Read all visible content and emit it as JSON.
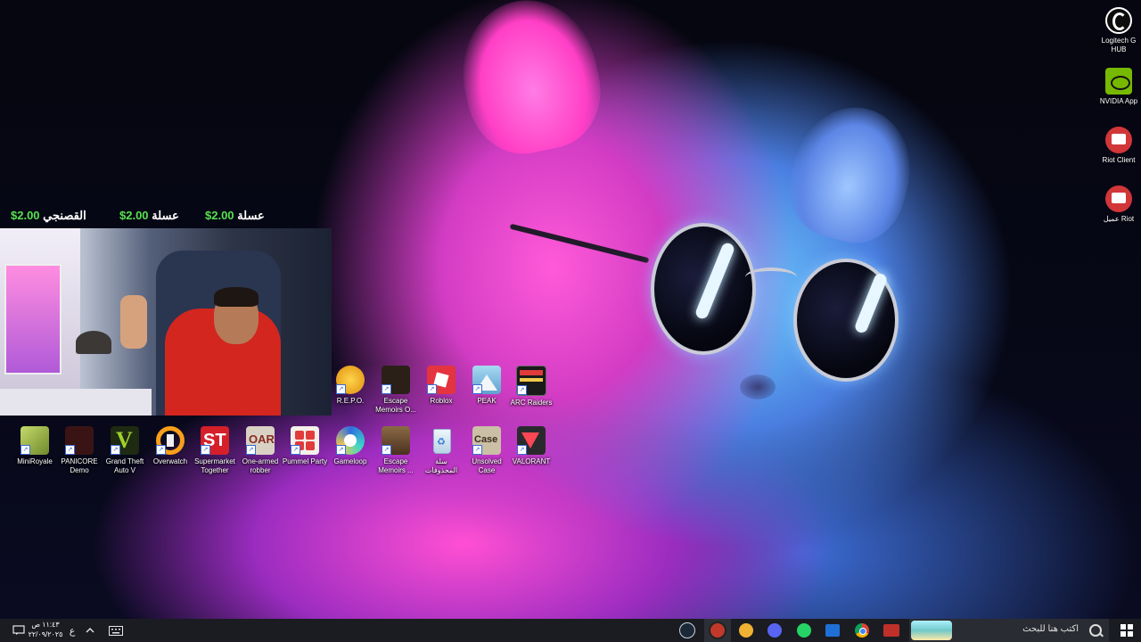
{
  "donations": [
    {
      "name": "القصنجي",
      "amount": "2.00$"
    },
    {
      "name": "عسلة",
      "amount": "2.00$"
    },
    {
      "name": "عسلة",
      "amount": "2.00$"
    }
  ],
  "right_icons": [
    {
      "label": "Logitech G HUB",
      "icon": "logitech-ghub-icon",
      "color": "#ffffff"
    },
    {
      "label": "NVIDIA App",
      "icon": "nvidia-icon",
      "color": "#76b900"
    },
    {
      "label": "Riot Client",
      "icon": "riot-client-icon",
      "color": "#d13639"
    },
    {
      "label": "عميل Riot",
      "icon": "riot-client-icon",
      "color": "#d13639"
    }
  ],
  "top_row_icons": [
    {
      "label": "R.E.P.O.",
      "icon": "repo-icon",
      "color": "#e8a322"
    },
    {
      "label": "Escape Memoirs O...",
      "icon": "escape-memoirs-icon",
      "color": "#2a2018"
    },
    {
      "label": "Roblox",
      "icon": "roblox-icon",
      "color": "#e3343f"
    },
    {
      "label": "PEAK",
      "icon": "peak-icon",
      "color": "#7ec2e6"
    },
    {
      "label": "ARC Raiders",
      "icon": "arc-raiders-icon",
      "color": "#1a1a1a"
    }
  ],
  "bottom_row_icons": [
    {
      "label": "MiniRoyale",
      "icon": "miniroyale-icon",
      "color": "#9bb04a"
    },
    {
      "label": "PANICORE Demo",
      "icon": "panicore-icon",
      "color": "#3a1414"
    },
    {
      "label": "Grand Theft Auto V",
      "icon": "gta-v-icon",
      "color": "#1e2a12"
    },
    {
      "label": "Overwatch",
      "icon": "overwatch-icon",
      "color": "#f99e1a"
    },
    {
      "label": "Supermarket Together",
      "icon": "supermarket-together-icon",
      "color": "#d5202a"
    },
    {
      "label": "One-armed robber",
      "icon": "one-armed-robber-icon",
      "color": "#8a2a22"
    },
    {
      "label": "Pummel Party",
      "icon": "pummel-party-icon",
      "color": "#e23b3b"
    },
    {
      "label": "Gameloop",
      "icon": "gameloop-icon",
      "color": "#2e6fe0"
    },
    {
      "label": "Escape Memoirs ...",
      "icon": "escape-memoirs-icon",
      "color": "#6b4a2a"
    },
    {
      "label": "سلة المحذوفات",
      "icon": "recycle-bin-icon",
      "color": "#cfe3f2"
    },
    {
      "label": "Unsolved Case",
      "icon": "unsolved-case-icon",
      "color": "#5a4a3a"
    },
    {
      "label": "VALORANT",
      "icon": "valorant-icon",
      "color": "#2a2a2e"
    }
  ],
  "taskbar": {
    "search_placeholder": "اكتب هنا للبحث",
    "time": "١١:٤٣ ص",
    "date": "٢٢/٠٩/٢٠٢٥",
    "lang": "ع",
    "apps": [
      {
        "icon": "steam-icon",
        "color": "#1b2838"
      },
      {
        "icon": "obs-record-icon",
        "color": "#c0392b"
      },
      {
        "icon": "discord-icon",
        "color": "#f0b232"
      },
      {
        "icon": "discord-purple-icon",
        "color": "#5865f2"
      },
      {
        "icon": "whatsapp-icon",
        "color": "#25d366"
      },
      {
        "icon": "mail-icon",
        "color": "#1f6fd6"
      },
      {
        "icon": "chrome-icon",
        "color": "#e6a32a"
      },
      {
        "icon": "media-app-icon",
        "color": "#c0302a"
      }
    ]
  }
}
